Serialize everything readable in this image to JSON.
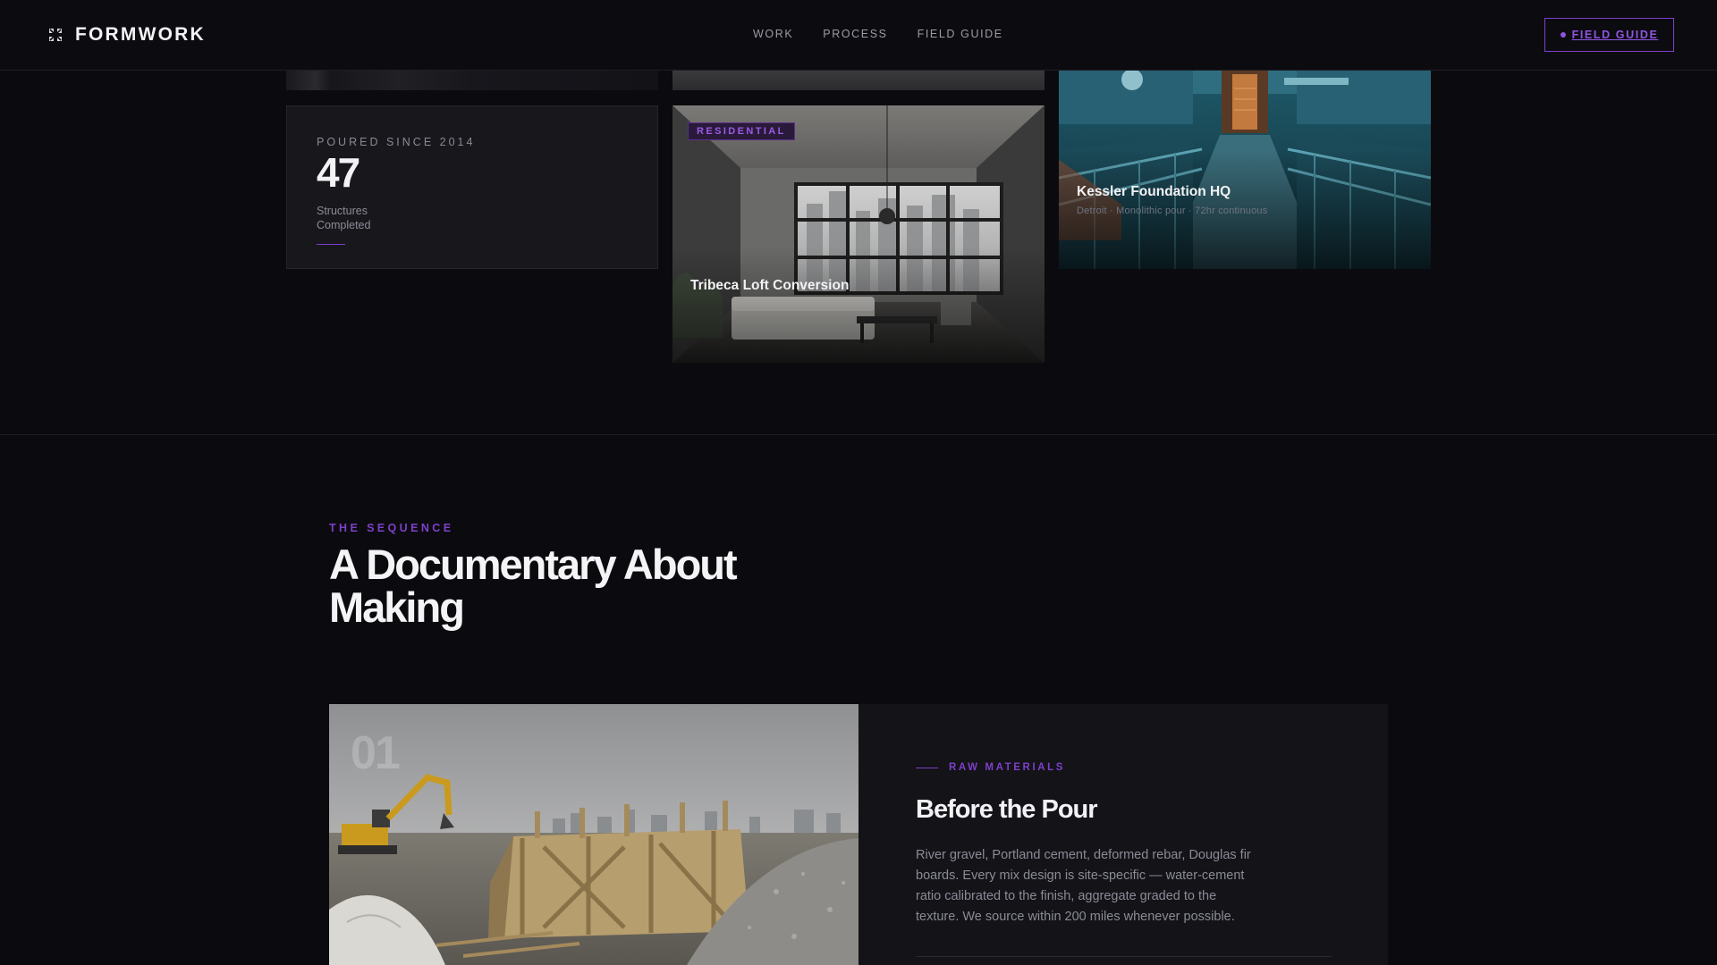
{
  "header": {
    "brand": "FORMWORK",
    "brand_icon": "grid-x-icon",
    "nav": [
      "WORK",
      "PROCESS",
      "FIELD GUIDE"
    ],
    "cta_label": "FIELD GUIDE"
  },
  "stat": {
    "eyebrow": "POURED SINCE 2014",
    "number": "47",
    "label": "Structures Completed"
  },
  "projects": [
    {
      "title": "Tribeca Loft Conversion",
      "tag": "RESIDENTIAL"
    },
    {
      "title": "Kessler Foundation HQ",
      "meta": "Detroit · Monolithic pour · 72hr continuous"
    }
  ],
  "sequence": {
    "eyebrow": "THE SEQUENCE",
    "title": "A Documentary About Making",
    "step": {
      "number": "01",
      "eyebrow": "RAW MATERIALS",
      "title": "Before the Pour",
      "body": "River gravel, Portland cement, deformed rebar, Douglas fir boards. Every mix design is site-specific — water-cement ratio calibrated to the finish, aggregate graded to the texture. We source within 200 miles whenever possible."
    }
  },
  "colors": {
    "accent": "#7d3fc9",
    "background": "#0b0b0f",
    "card": "#17171c"
  }
}
